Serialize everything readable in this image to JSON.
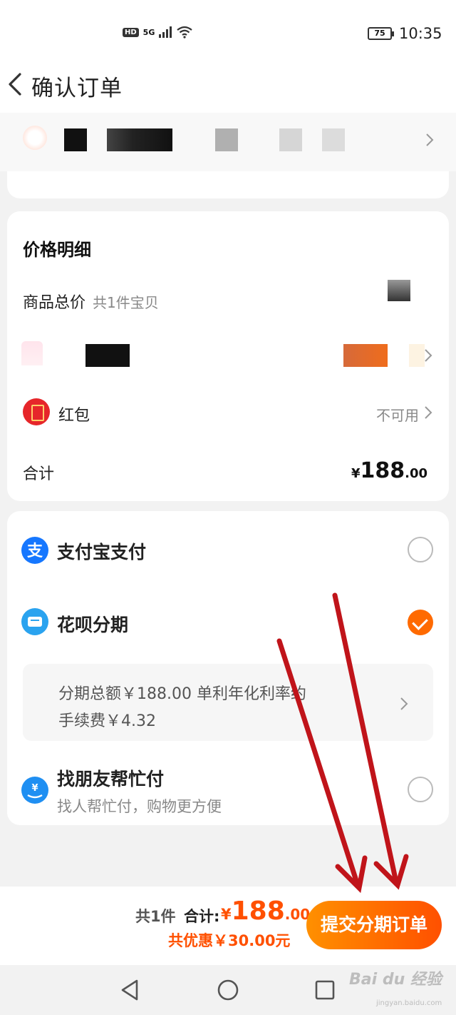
{
  "status_bar": {
    "network": "HD",
    "signal": "5G",
    "battery": "75",
    "time": "10:35"
  },
  "header": {
    "title": "确认订单"
  },
  "price_details": {
    "title": "价格明细",
    "goods_total_label": "商品总价",
    "goods_total_sub": "共1件宝贝",
    "redpacket_label": "红包",
    "redpacket_status": "不可用",
    "total_label": "合计",
    "total_currency": "¥",
    "total_int": "188",
    "total_dec": ".00"
  },
  "payment": {
    "alipay_label": "支付宝支付",
    "huabei_label": "花呗分期",
    "installment_line1": "分期总额￥188.00 单利年化利率约",
    "installment_line2": "手续费￥4.32",
    "friend_label": "找朋友帮忙付",
    "friend_sub": "找人帮忙付，购物更方便",
    "selected": "huabei"
  },
  "bottom_bar": {
    "count": "共1件",
    "total_label": "合计:",
    "currency": "¥",
    "amount_int": "188",
    "amount_dec": ".00",
    "discount": "共优惠￥30.00元",
    "submit_label": "提交分期订单"
  },
  "watermark": {
    "text": "Bai du 经验",
    "sub": "jingyan.baidu.com"
  },
  "colors": {
    "accent": "#ff5000",
    "alipay_blue": "#1677ff",
    "arrow_red": "#c0141a"
  }
}
